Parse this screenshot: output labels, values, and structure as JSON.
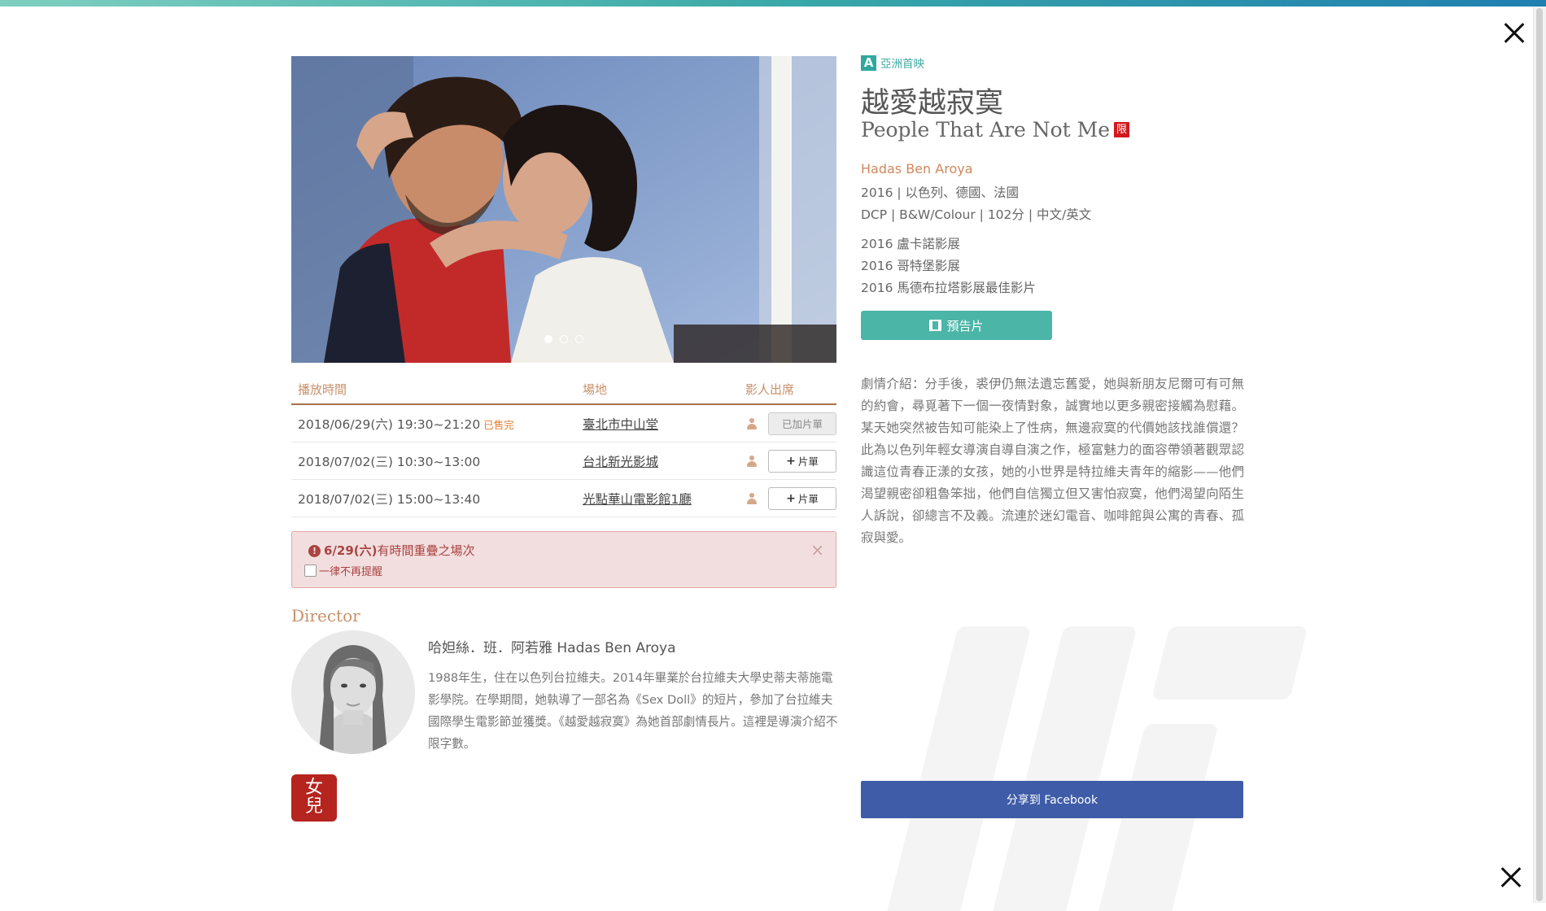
{
  "film": {
    "premiere_badge": "A",
    "premiere_label": "亞洲首映",
    "title_zh": "越愛越寂寞",
    "title_en": "People That Are Not Me",
    "rating_badge": "限",
    "director": "Hadas Ben Aroya",
    "info_line1": "2016 | 以色列、德國、法國",
    "info_line2": "DCP | B&W/Colour | 102分 | 中文/英文",
    "festivals": [
      "2016 盧卡諾影展",
      "2016 哥特堡影展",
      "2016 馬德布拉塔影展最佳影片"
    ],
    "trailer_label": "預告片",
    "synopsis": "劇情介紹：分手後，裘伊仍無法遺忘舊愛，她與新朋友尼爾可有可無的約會，尋覓著下一個一夜情對象，誠實地以更多親密接觸為慰藉。某天她突然被告知可能染上了性病，無邊寂寞的代價她該找誰償還？此為以色列年輕女導演自導自演之作，極富魅力的面容帶領著觀眾認識這位青春正漾的女孩，她的小世界是特拉維夫青年的縮影——他們渴望親密卻粗魯笨拙，他們自信獨立但又害怕寂寞，他們渴望向陌生人訴說，卻總言不及義。流連於迷幻電音、咖啡館與公寓的青春、孤寂與愛。",
    "share_label": "分享到 Facebook"
  },
  "carousel": {
    "slides": 3,
    "active": 0
  },
  "schedule": {
    "headers": {
      "time": "播放時間",
      "venue": "場地",
      "guest": "影人出席"
    },
    "rows": [
      {
        "time": "2018/06/29(六)  19:30~21:20",
        "status": "已售完",
        "venue": "臺北市中山堂",
        "button": "已加片單",
        "added": true
      },
      {
        "time": "2018/07/02(三)  10:30~13:00",
        "status": "",
        "venue": "台北新光影城",
        "button": "片單",
        "added": false
      },
      {
        "time": "2018/07/02(三)  15:00~13:40",
        "status": "",
        "venue": "光點華山電影館1廳",
        "button": "片單",
        "added": false
      }
    ]
  },
  "alert": {
    "message_bold": "6/29(六)",
    "message_rest": "有時間重疊之場次",
    "checkbox_label": "一律不再提醒",
    "close": "×"
  },
  "director_section": {
    "heading": "Director",
    "name": "哈妲絲．班．阿若雅 Hadas Ben Aroya",
    "bio": "1988年生，住在以色列台拉維夫。2014年畢業於台拉維夫大學史蒂夫蒂施電影學院。在學期間，她執導了一部名為《Sex Doll》的短片，參加了台拉維夫國際學生電影節並獲獎。《越愛越寂寞》為她首部劇情長片。這裡是導演介紹不限字數。"
  },
  "seal": {
    "line1": "女",
    "line2": "兒"
  },
  "icons": {
    "close": "close-icon",
    "film": "film-icon",
    "guest": "person-icon",
    "alert": "exclamation-circle-icon"
  },
  "colors": {
    "accent_teal": "#4bb5a7",
    "brand_brown": "#c8906a",
    "facebook_blue": "#3f5ca8",
    "alert_bg": "#f2dede",
    "rating_red": "#d2191e"
  }
}
